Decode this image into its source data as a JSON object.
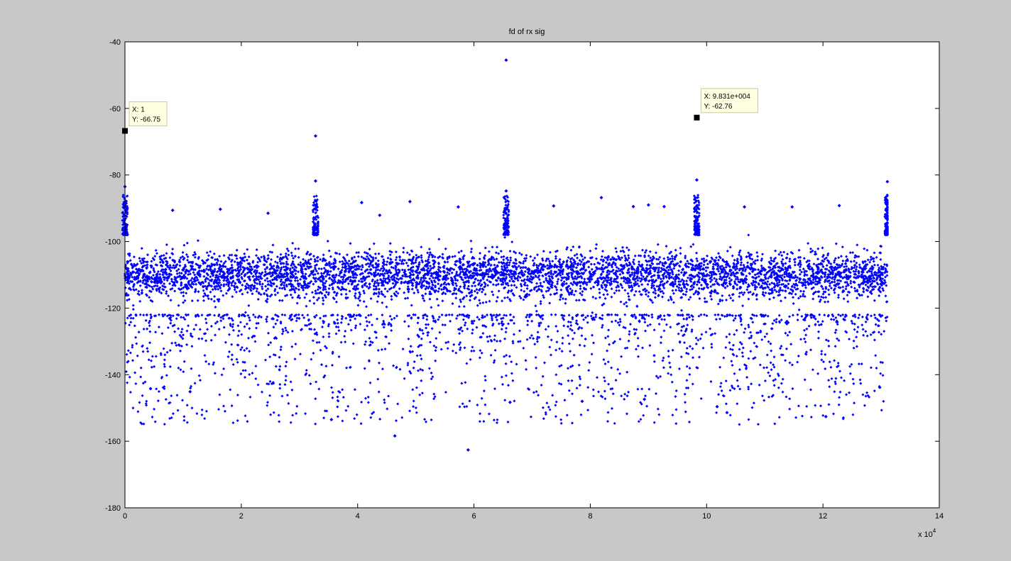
{
  "chart_data": {
    "type": "scatter",
    "title": "fd of rx sig",
    "xlabel": "",
    "ylabel": "",
    "xlim": [
      0,
      140000
    ],
    "ylim": [
      -180,
      -40
    ],
    "x_tick_labels": [
      "0",
      "2",
      "4",
      "6",
      "8",
      "10",
      "12",
      "14"
    ],
    "x_tick_values": [
      0,
      20000,
      40000,
      60000,
      80000,
      100000,
      120000,
      140000
    ],
    "x_exponent_label": "x 10",
    "x_exponent_power": "4",
    "y_tick_values": [
      -40,
      -60,
      -80,
      -100,
      -120,
      -140,
      -160,
      -180
    ],
    "y_tick_labels": [
      "-40",
      "-60",
      "-80",
      "-100",
      "-120",
      "-140",
      "-160",
      "-180"
    ],
    "grid": false,
    "marker_color": "#0000ff",
    "point_count_approx": 131072,
    "noise_floor": {
      "x_range": [
        0,
        131072
      ],
      "dense_band_y": [
        -122,
        -98
      ],
      "sparse_tail_y": [
        -163,
        -122
      ]
    },
    "spurs": [
      {
        "x": 1,
        "y": -66.75
      },
      {
        "x": 0,
        "y": -83.5
      },
      {
        "x": 32768,
        "y": -68.3
      },
      {
        "x": 32768,
        "y": -81.8
      },
      {
        "x": 65536,
        "y": -45.5
      },
      {
        "x": 65536,
        "y": -84.8
      },
      {
        "x": 98310,
        "y": -62.76
      },
      {
        "x": 98310,
        "y": -81.5
      },
      {
        "x": 131072,
        "y": -82
      }
    ],
    "outliers": [
      {
        "x": 8200,
        "y": -90.6
      },
      {
        "x": 16400,
        "y": -90.3
      },
      {
        "x": 24600,
        "y": -91.5
      },
      {
        "x": 40700,
        "y": -88.3
      },
      {
        "x": 43800,
        "y": -92.1
      },
      {
        "x": 49000,
        "y": -88
      },
      {
        "x": 57300,
        "y": -89.6
      },
      {
        "x": 73700,
        "y": -89.3
      },
      {
        "x": 81900,
        "y": -86.8
      },
      {
        "x": 87400,
        "y": -89.5
      },
      {
        "x": 90000,
        "y": -89
      },
      {
        "x": 92700,
        "y": -89.5
      },
      {
        "x": 106500,
        "y": -89.6
      },
      {
        "x": 114700,
        "y": -89.6
      },
      {
        "x": 122800,
        "y": -89.2
      },
      {
        "x": 35500,
        "y": -153.5
      },
      {
        "x": 46400,
        "y": -158.4
      },
      {
        "x": 59000,
        "y": -162.6
      },
      {
        "x": 120500,
        "y": -152.6
      },
      {
        "x": 103500,
        "y": -151.4
      },
      {
        "x": 101800,
        "y": -149.6
      },
      {
        "x": 89300,
        "y": -147.4
      },
      {
        "x": 78600,
        "y": -148
      },
      {
        "x": 66200,
        "y": -148.3
      },
      {
        "x": 11200,
        "y": -145.1
      },
      {
        "x": 4400,
        "y": -144.2
      }
    ],
    "datatips": [
      {
        "x_text": "X: 1",
        "y_text": "Y: -66.75",
        "x": 1,
        "y": -66.75
      },
      {
        "x_text": "X: 9.831e+004",
        "y_text": "Y: -62.76",
        "x": 98310,
        "y": -62.76
      }
    ]
  }
}
